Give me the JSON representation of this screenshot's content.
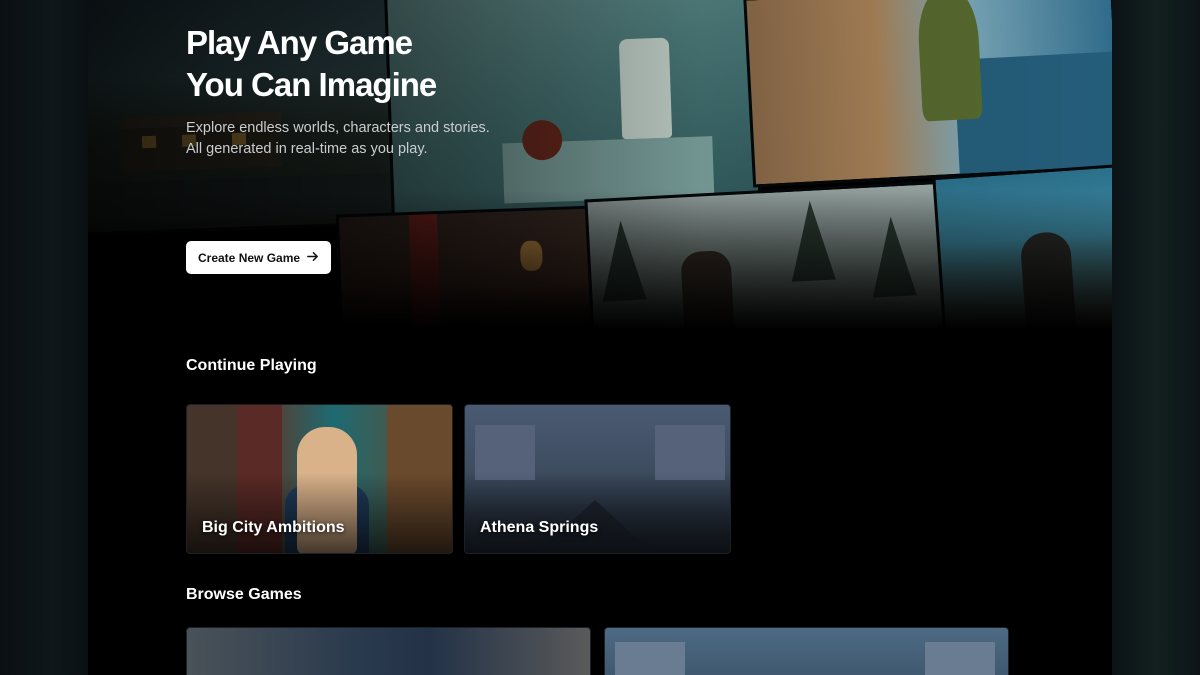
{
  "hero": {
    "title_line1": "Play Any Game",
    "title_line2": "You Can Imagine",
    "subtitle": "Explore endless worlds, characters and stories. All generated in real-time as you play.",
    "cta_label": "Create New Game",
    "cta_icon": "arrow-right-icon"
  },
  "continue_playing": {
    "title": "Continue Playing",
    "games": [
      {
        "title": "Big City Ambitions"
      },
      {
        "title": "Athena Springs"
      }
    ]
  },
  "browse_games": {
    "title": "Browse Games"
  },
  "colors": {
    "background": "#000000",
    "cta_bg": "#ffffff",
    "cta_text": "#111111",
    "subtitle_text": "#c9cdd0"
  }
}
